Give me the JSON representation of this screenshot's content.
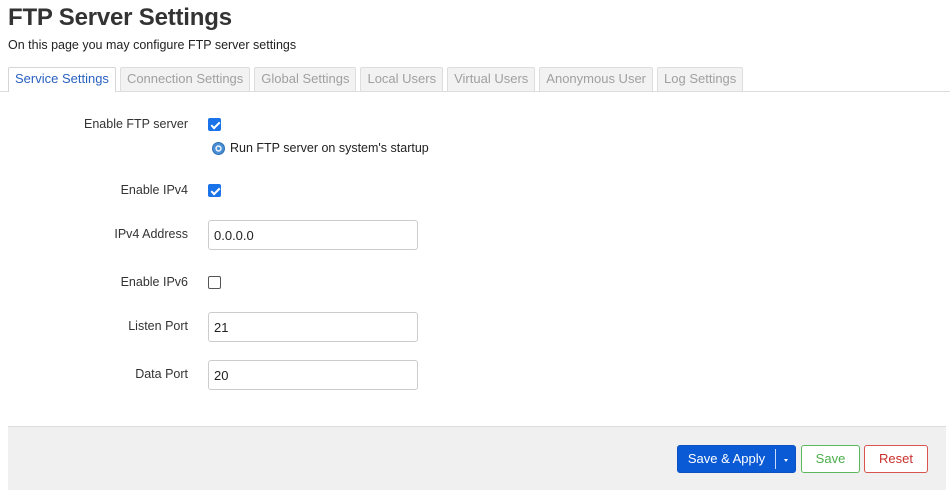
{
  "header": {
    "title": "FTP Server Settings",
    "description": "On this page you may configure FTP server settings"
  },
  "tabs": [
    {
      "label": "Service Settings",
      "active": true
    },
    {
      "label": "Connection Settings",
      "active": false
    },
    {
      "label": "Global Settings",
      "active": false
    },
    {
      "label": "Local Users",
      "active": false
    },
    {
      "label": "Virtual Users",
      "active": false
    },
    {
      "label": "Anonymous User",
      "active": false
    },
    {
      "label": "Log Settings",
      "active": false
    }
  ],
  "form": {
    "enable_ftp": {
      "label": "Enable FTP server",
      "checked": true,
      "hint": "Run FTP server on system's startup"
    },
    "enable_ipv4": {
      "label": "Enable IPv4",
      "checked": true
    },
    "ipv4_address": {
      "label": "IPv4 Address",
      "value": "0.0.0.0"
    },
    "enable_ipv6": {
      "label": "Enable IPv6",
      "checked": false
    },
    "listen_port": {
      "label": "Listen Port",
      "value": "21"
    },
    "data_port": {
      "label": "Data Port",
      "value": "20"
    }
  },
  "actions": {
    "save_apply": "Save & Apply",
    "save": "Save",
    "reset": "Reset"
  },
  "icons": {
    "hint": "info-icon",
    "dropdown": "caret-down-icon"
  },
  "colors": {
    "accent": "#0a5ad6",
    "save": "#5cb85c",
    "reset": "#d9534f",
    "active_tab": "#2a62c0"
  }
}
